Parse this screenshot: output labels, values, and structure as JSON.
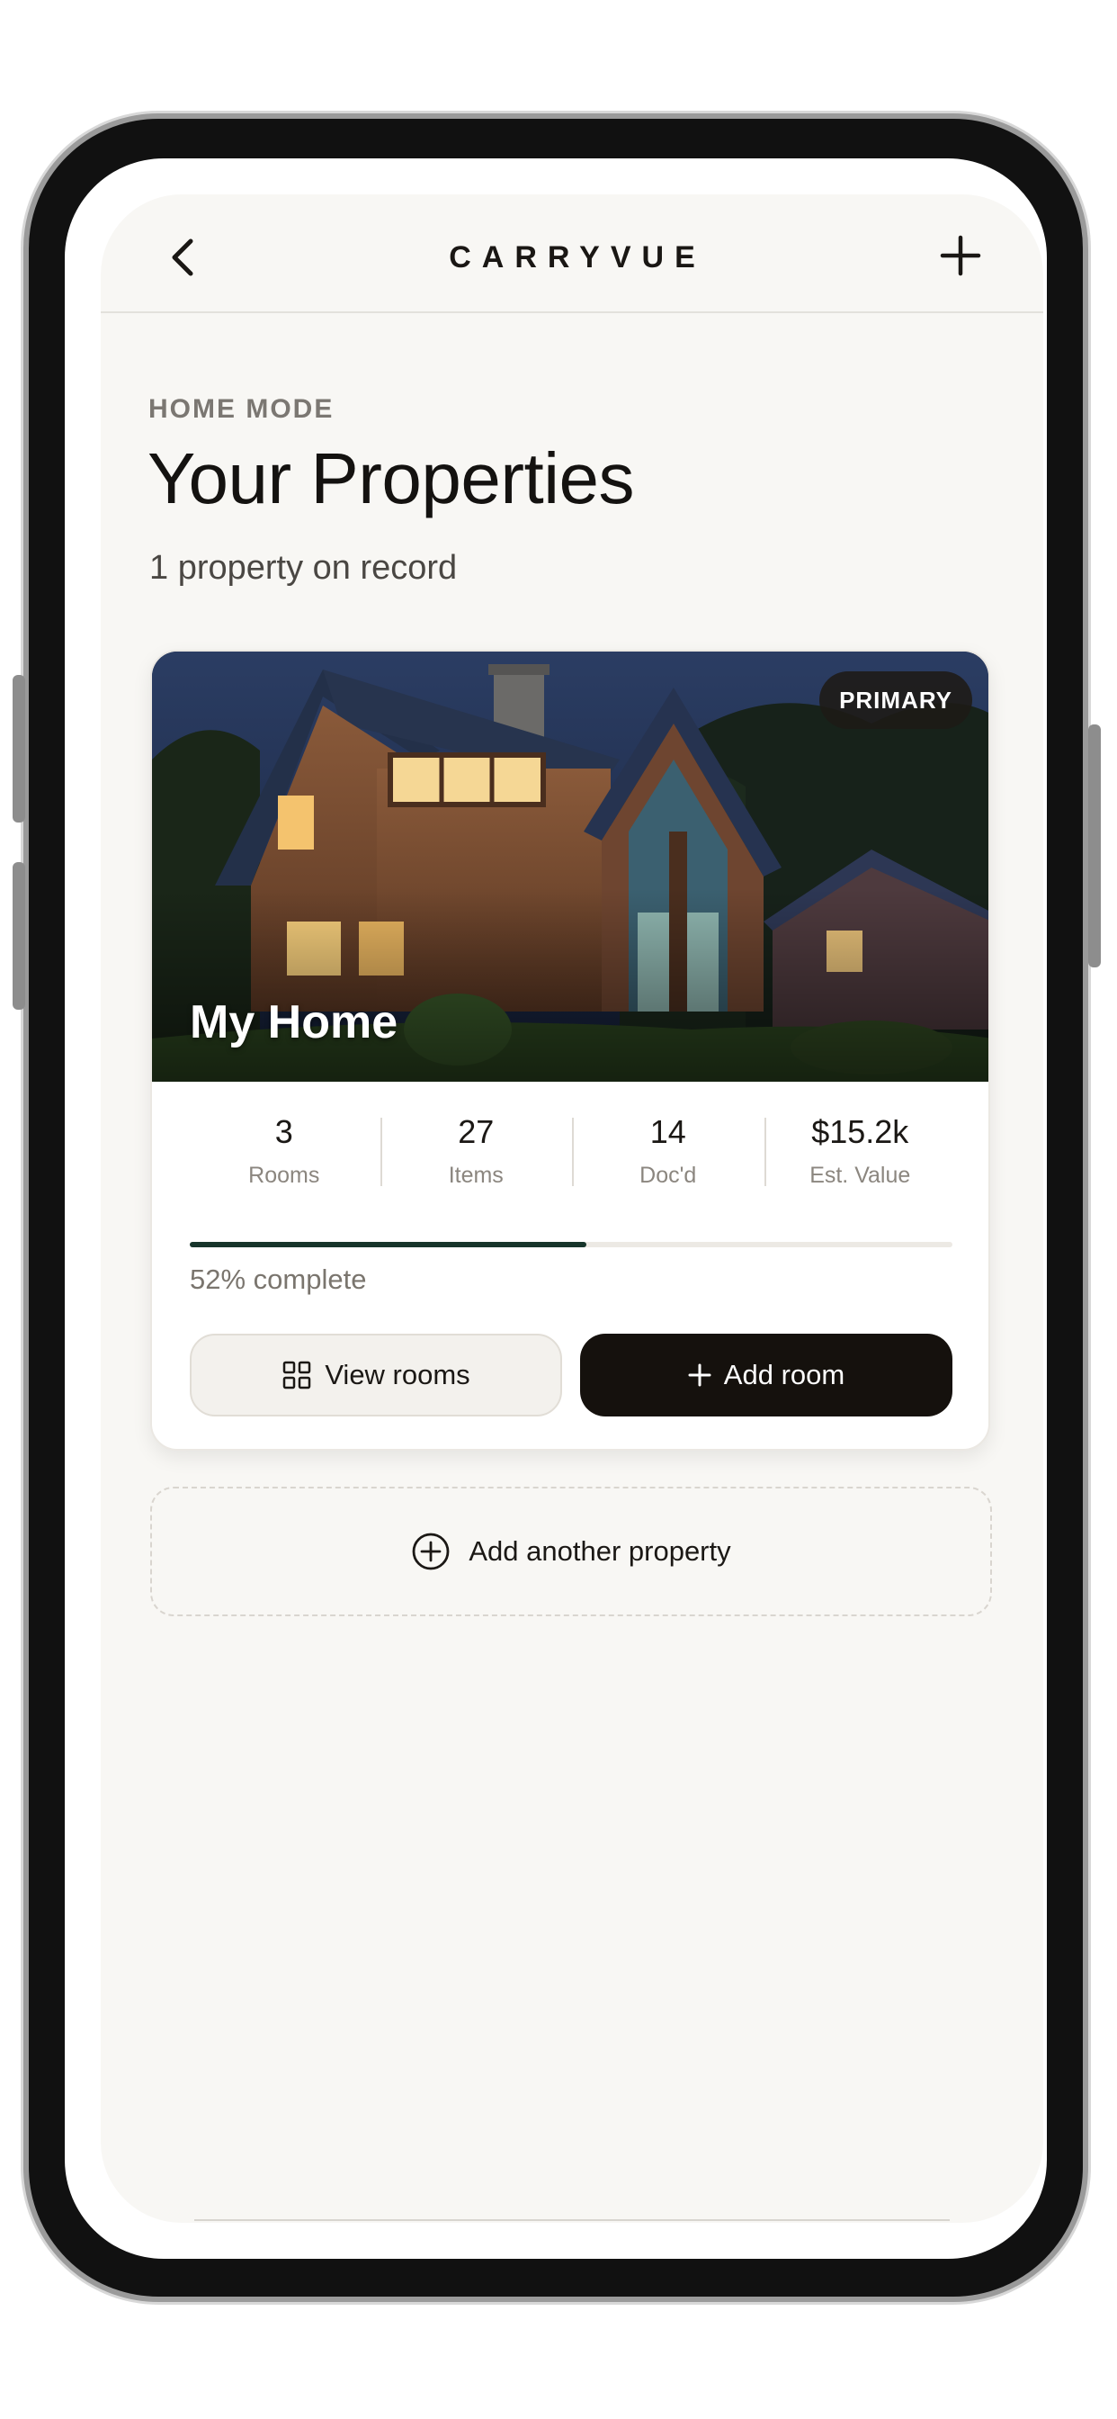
{
  "header": {
    "brand": "CARRYVUE",
    "back_icon": "chevron-left-icon",
    "add_icon": "plus-icon"
  },
  "page": {
    "eyebrow": "HOME MODE",
    "title": "Your Properties",
    "subtitle": "1 property on record"
  },
  "property": {
    "name": "My Home",
    "badge": "PRIMARY",
    "stats": [
      {
        "value": "3",
        "label": "Rooms"
      },
      {
        "value": "27",
        "label": "Items"
      },
      {
        "value": "14",
        "label": "Doc'd"
      },
      {
        "value": "$15.2k",
        "label": "Est. Value"
      }
    ],
    "progress_percent": 52,
    "progress_text": "52% complete",
    "view_rooms_label": "View rooms",
    "add_room_label": "Add room"
  },
  "add_property_label": "Add another property",
  "colors": {
    "background": "#f8f7f4",
    "primary_button": "#15110d",
    "progress_fill": "#17352b",
    "text_dark": "#141210",
    "text_muted": "#7b7772"
  }
}
